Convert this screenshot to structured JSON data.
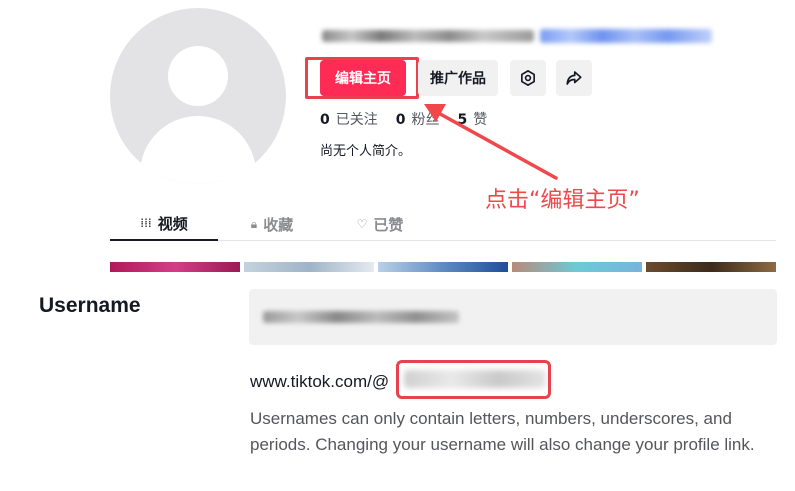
{
  "profile": {
    "edit_button": "编辑主页",
    "promote_button": "推广作品",
    "settings_icon": "gear-icon",
    "share_icon": "share-arrow-icon",
    "stats": [
      {
        "value": "0",
        "label": "已关注"
      },
      {
        "value": "0",
        "label": "粉丝"
      },
      {
        "value": "5",
        "label": "赞"
      }
    ],
    "bio": "尚无个人简介。"
  },
  "annotation": {
    "text": "点击“编辑主页”",
    "color": "#f0474b"
  },
  "tabs": [
    {
      "icon": "grid-icon",
      "glyph": "⁞⁞⁞",
      "label": "视频"
    },
    {
      "icon": "lock-icon",
      "glyph": "🔒︎",
      "label": "收藏"
    },
    {
      "icon": "heart-icon",
      "glyph": "♡",
      "label": "已赞"
    }
  ],
  "settings": {
    "section_label": "Username",
    "url_prefix": "www.tiktok.com/@",
    "help_text": "Usernames can only contain letters, numbers, underscores, and periods. Changing your username will also change your profile link."
  },
  "colors": {
    "brand": "#fe2c55",
    "highlight": "#e8424f"
  }
}
